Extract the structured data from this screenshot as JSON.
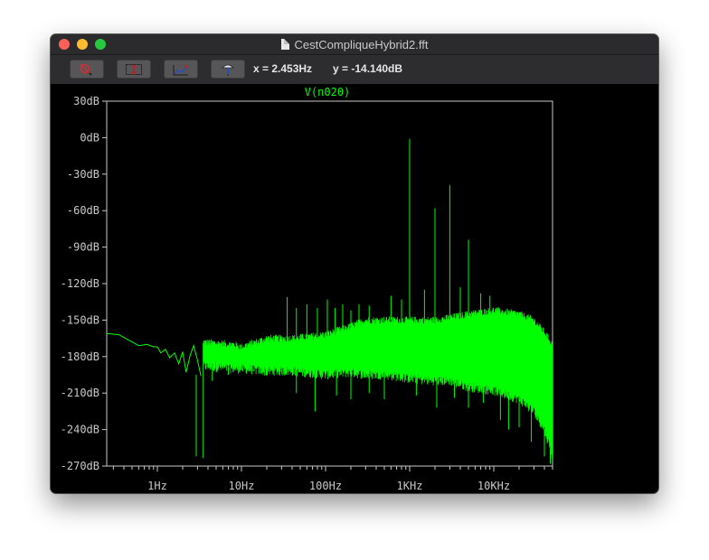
{
  "window": {
    "title": "CestCompliqueHybrid2.fft"
  },
  "toolbar": {
    "buttons": [
      {
        "name": "zoom-cancel-button",
        "icon": "magnifier-cross-icon"
      },
      {
        "name": "autorange-button",
        "icon": "autorange-icon"
      },
      {
        "name": "zoom-to-fit-button",
        "icon": "zoom-fit-icon"
      },
      {
        "name": "probe-button",
        "icon": "probe-icon"
      }
    ],
    "cursor_x": "x = 2.453Hz",
    "cursor_y": "y = -14.140dB"
  },
  "colors": {
    "trace": "#00ff00",
    "background": "#000000",
    "axes": "#c0c0c0"
  },
  "chart_data": {
    "type": "line",
    "title": "V(n020)",
    "xscale": "log",
    "xlim": [
      0.25,
      50000
    ],
    "ylim": [
      -270,
      30
    ],
    "xticks": [
      {
        "value": 1,
        "label": "1Hz"
      },
      {
        "value": 10,
        "label": "10Hz"
      },
      {
        "value": 100,
        "label": "100Hz"
      },
      {
        "value": 1000,
        "label": "1KHz"
      },
      {
        "value": 10000,
        "label": "10KHz"
      }
    ],
    "yticks": [
      {
        "value": 30,
        "label": "30dB"
      },
      {
        "value": 0,
        "label": "0dB"
      },
      {
        "value": -30,
        "label": "-30dB"
      },
      {
        "value": -60,
        "label": "-60dB"
      },
      {
        "value": -90,
        "label": "-90dB"
      },
      {
        "value": -120,
        "label": "-120dB"
      },
      {
        "value": -150,
        "label": "-150dB"
      },
      {
        "value": -180,
        "label": "-180dB"
      },
      {
        "value": -210,
        "label": "-210dB"
      },
      {
        "value": -240,
        "label": "-240dB"
      },
      {
        "value": -270,
        "label": "-270dB"
      }
    ],
    "series": [
      {
        "name": "V(n020)",
        "smooth": [
          [
            0.25,
            -161
          ],
          [
            0.35,
            -162
          ],
          [
            0.5,
            -168
          ],
          [
            0.6,
            -171
          ],
          [
            0.75,
            -170
          ],
          [
            0.9,
            -172
          ],
          [
            1.0,
            -172
          ],
          [
            1.1,
            -177
          ],
          [
            1.25,
            -174
          ],
          [
            1.4,
            -181
          ],
          [
            1.6,
            -177
          ],
          [
            1.8,
            -186
          ],
          [
            2.0,
            -176
          ],
          [
            2.2,
            -193
          ],
          [
            2.45,
            -179
          ],
          [
            2.7,
            -171
          ],
          [
            3.0,
            -183
          ],
          [
            3.3,
            -196
          ]
        ],
        "noise_band": [
          [
            3.5,
            -168,
            -188
          ],
          [
            8,
            -170,
            -190
          ],
          [
            10,
            -172,
            -190
          ],
          [
            20,
            -165,
            -192
          ],
          [
            40,
            -165,
            -192
          ],
          [
            100,
            -162,
            -195
          ],
          [
            200,
            -155,
            -193
          ],
          [
            300,
            -150,
            -195
          ],
          [
            500,
            -150,
            -195
          ],
          [
            1000,
            -150,
            -198
          ],
          [
            2000,
            -150,
            -200
          ],
          [
            3000,
            -148,
            -200
          ],
          [
            5000,
            -145,
            -205
          ],
          [
            10000,
            -142,
            -208
          ],
          [
            20000,
            -145,
            -215
          ],
          [
            30000,
            -150,
            -225
          ],
          [
            40000,
            -160,
            -240
          ],
          [
            50000,
            -170,
            -262
          ]
        ],
        "peaks": [
          [
            1000,
            -1
          ],
          [
            3000,
            -39
          ],
          [
            2000,
            -58
          ],
          [
            5000,
            -84
          ],
          [
            4000,
            -123
          ],
          [
            7000,
            -128
          ],
          [
            9000,
            -130
          ],
          [
            1500,
            -125
          ],
          [
            800,
            -133
          ],
          [
            600,
            -130
          ],
          [
            35,
            -131
          ],
          [
            45,
            -140
          ],
          [
            60,
            -137
          ],
          [
            80,
            -140
          ],
          [
            105,
            -133
          ],
          [
            130,
            -140
          ],
          [
            160,
            -137
          ],
          [
            200,
            -142
          ],
          [
            250,
            -137
          ],
          [
            330,
            -138
          ]
        ],
        "dips": [
          [
            2.9,
            -195
          ],
          [
            4.5,
            -200
          ],
          [
            7,
            -195
          ],
          [
            14,
            -192
          ],
          [
            20,
            -196
          ],
          [
            45,
            -210
          ],
          [
            75,
            -225
          ],
          [
            135,
            -212
          ],
          [
            200,
            -215
          ],
          [
            330,
            -210
          ],
          [
            500,
            -215
          ],
          [
            1200,
            -212
          ],
          [
            2100,
            -222
          ],
          [
            3400,
            -214
          ],
          [
            5000,
            -222
          ],
          [
            7500,
            -218
          ],
          [
            12000,
            -232
          ],
          [
            15000,
            -240
          ],
          [
            20000,
            -238
          ],
          [
            28000,
            -250
          ],
          [
            40000,
            -262
          ],
          [
            47000,
            -268
          ]
        ]
      }
    ]
  }
}
